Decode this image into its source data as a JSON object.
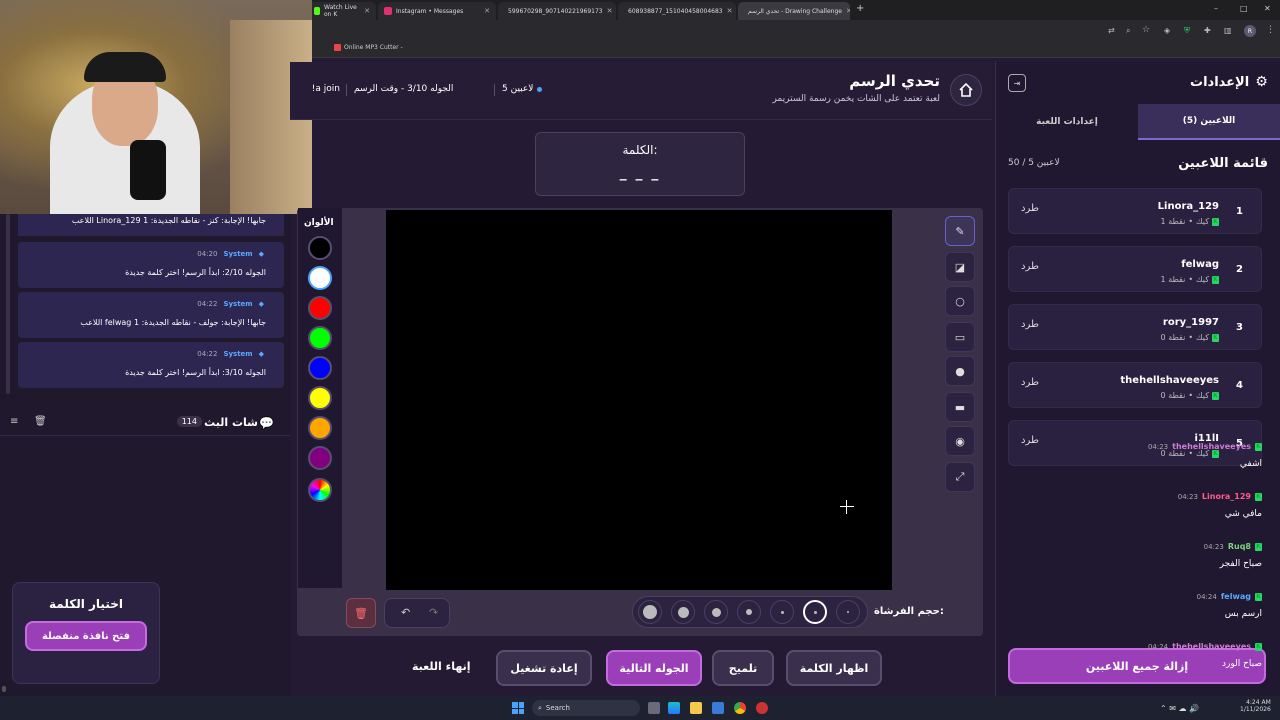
{
  "browser": {
    "tabs": [
      {
        "label": "Watch Live on K",
        "color": "#53fc18"
      },
      {
        "label": "Instagram • Messages",
        "color": "#e1306c"
      },
      {
        "label": "599670298_907140221969173",
        "color": "#1877f2"
      },
      {
        "label": "608938877_151040458004683",
        "color": "#1877f2"
      },
      {
        "label": "تحدي الرسم - Drawing Challenge",
        "color": "#9a6bff"
      }
    ],
    "new_tab": "+",
    "bookmark": "Online MP3 Cutter -",
    "profile": "R",
    "window_controls": [
      "–",
      "□",
      "✕"
    ]
  },
  "header": {
    "title": "تحدي الرسم",
    "subtitle": "لعبة تعتمد على الشات يخمن رسمة الستريمر",
    "players_count": "5 لاعبين",
    "round_info": "الجوله 3/10 - وقت الرسم",
    "join_text": "a join!"
  },
  "word_box": {
    "label": "الكلمة:",
    "word": "_ _ _"
  },
  "colors_label": "الألوان",
  "palette": [
    "#000000",
    "#ffffff",
    "#ff0000",
    "#00ff00",
    "#0000ff",
    "#ffff00",
    "#ffa500",
    "#800080"
  ],
  "brush_label": "حجم الفرشاة:",
  "brush_sizes": [
    14,
    11,
    9,
    6,
    3,
    3,
    2
  ],
  "tools": [
    "pencil-icon",
    "eraser-icon",
    "circle-icon",
    "rectangle-icon",
    "filled-circle-icon",
    "filled-rectangle-icon",
    "fill-bucket-icon",
    "line-icon"
  ],
  "actions": {
    "reveal_word": "اظهار الكلمة",
    "hint": "تلميح",
    "next_round": "الجوله التالية",
    "restart": "إعادة تشغيل",
    "end_game": "إنهاء اللعبة"
  },
  "settings": {
    "title": "الإعدادات",
    "tab_players": "اللاعبين (5)",
    "tab_game": "إعدادات اللعبة",
    "list_title": "قائمة اللاعبين",
    "capacity": "50 / 5 لاعبين",
    "kick_label": "طرد",
    "remove_all": "إزالة جميع اللاعبين",
    "players": [
      {
        "rank": "1",
        "name": "Linora_129",
        "platform": "كيك",
        "points": "1 نقطة"
      },
      {
        "rank": "2",
        "name": "felwag",
        "platform": "كيك",
        "points": "1 نقطة"
      },
      {
        "rank": "3",
        "name": "rory_1997",
        "platform": "كيك",
        "points": "0 نقطة"
      },
      {
        "rank": "4",
        "name": "thehellshaveeyes",
        "platform": "كيك",
        "points": "0 نقطة"
      },
      {
        "rank": "5",
        "name": "i11lI",
        "platform": "كيك",
        "points": "0 نقطة"
      }
    ]
  },
  "system_log": {
    "partial": "اللاعب Linora_129 جابها! الإجابة: كنز - نقاطه الجديدة: 1",
    "messages": [
      {
        "time": "04:20",
        "sender": "System",
        "text": "الجوله 2/10: ابدأ الرسم! اختر كلمة جديدة"
      },
      {
        "time": "04:22",
        "sender": "System",
        "text": "اللاعب felwag جابها! الإجابة: جولف - نقاطه الجديدة: 1"
      },
      {
        "time": "04:22",
        "sender": "System",
        "text": "الجوله 3/10: ابدأ الرسم! اختر كلمة جديدة"
      }
    ]
  },
  "stream_chat": {
    "title": "شات البث",
    "count": "114",
    "messages": [
      {
        "time": "04:23",
        "user": "thehellshaveeyes",
        "color": "#d07bd4",
        "text": "اشفي"
      },
      {
        "time": "04:23",
        "user": "Linora_129",
        "color": "#ff5c8a",
        "text": "مافي شي"
      },
      {
        "time": "04:23",
        "user": "Ruq8",
        "color": "#7bd47b",
        "text": "صباح الفجر"
      },
      {
        "time": "04:24",
        "user": "felwag",
        "color": "#5aa8ff",
        "text": "ارسم بس"
      },
      {
        "time": "04:24",
        "user": "thehellshaveeyes",
        "color": "#d07bd4",
        "text": "صباح الورد"
      }
    ]
  },
  "word_choice": {
    "title": "اختيار الكلمة",
    "button": "فتح نافذة منفصلة"
  },
  "taskbar": {
    "search": "Search",
    "time": "4:24 AM",
    "date": "1/11/2026"
  }
}
